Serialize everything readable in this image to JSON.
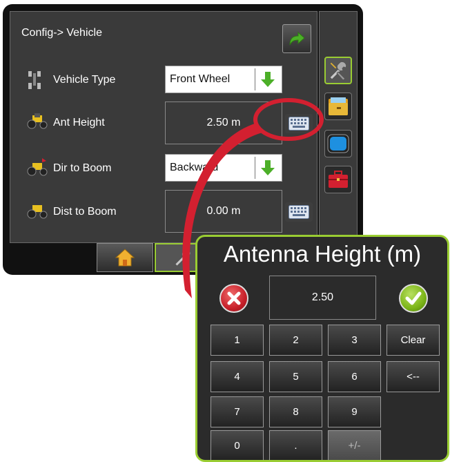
{
  "screen": {
    "title": "Config-> Vehicle",
    "rows": [
      {
        "label": "Vehicle Type",
        "value": "Front Wheel",
        "control": "dropdown"
      },
      {
        "label": "Ant Height",
        "value": "2.50 m",
        "control": "keyboard"
      },
      {
        "label": "Dir to Boom",
        "value": "Backward",
        "control": "dropdown"
      },
      {
        "label": "Dist to Boom",
        "value": "0.00 m",
        "control": "keyboard"
      }
    ]
  },
  "side_tabs": [
    "tools-icon",
    "folder-icon",
    "display-icon",
    "toolbox-icon"
  ],
  "bottom_tabs": [
    "home-icon",
    "tools-icon"
  ],
  "keypad": {
    "title": "Antenna Height (m)",
    "display": "2.50",
    "keys": {
      "k1": "1",
      "k2": "2",
      "k3": "3",
      "clear": "Clear",
      "k4": "4",
      "k5": "5",
      "k6": "6",
      "back": "<--",
      "k7": "7",
      "k8": "8",
      "k9": "9",
      "k0": "0",
      "dot": ".",
      "plusminus": "+/-"
    }
  },
  "colors": {
    "accent_green": "#9acd32",
    "callout_red": "#d32030",
    "arrow_green": "#4caf28",
    "cancel_red": "#c8202a",
    "confirm_green": "#7cb518"
  }
}
